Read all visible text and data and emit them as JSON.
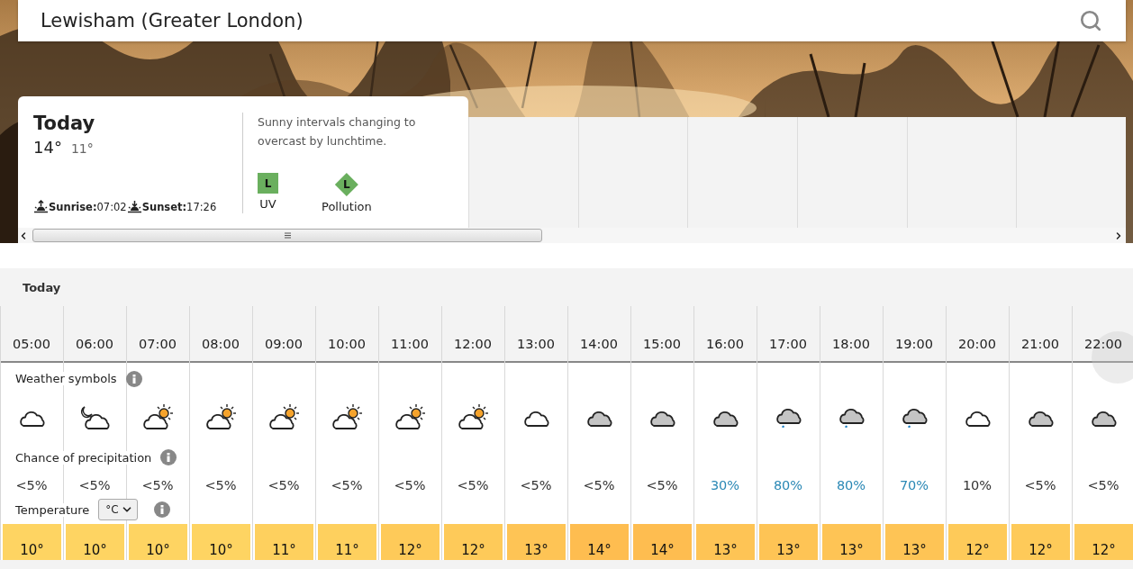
{
  "search": {
    "value": "Lewisham (Greater London)"
  },
  "today": {
    "title": "Today",
    "high": "14°",
    "low": "11°",
    "sunrise": "**Sunrise:**07:02",
    "sunset": "**Sunset:**17:26",
    "summary": "Sunny intervals changing to overcast by lunchtime.",
    "indices": [
      {
        "kind": "square",
        "value": "L",
        "label": "UV",
        "color": "#6aaf5e"
      },
      {
        "kind": "diamond",
        "value": "L",
        "label": "Pollution",
        "color": "#6aaf5e"
      }
    ]
  },
  "hourly": {
    "title": "Today",
    "symbols_label": "Weather symbols",
    "precip_label": "Chance of precipitation",
    "temp_label": "Temperature",
    "unit": "°C",
    "hours": [
      {
        "time": "05:00",
        "kind": "cloud",
        "precip": {
          "value": "<5%",
          "color": "#333333"
        },
        "temp": {
          "value": "10°",
          "color": "#fed462"
        }
      },
      {
        "time": "06:00",
        "kind": "moon",
        "precip": {
          "value": "<5%",
          "color": "#333333"
        },
        "temp": {
          "value": "10°",
          "color": "#fed462"
        }
      },
      {
        "time": "07:00",
        "kind": "sunny",
        "precip": {
          "value": "<5%",
          "color": "#333333"
        },
        "temp": {
          "value": "10°",
          "color": "#fed462"
        }
      },
      {
        "time": "08:00",
        "kind": "sunny",
        "precip": {
          "value": "<5%",
          "color": "#333333"
        },
        "temp": {
          "value": "10°",
          "color": "#fed462"
        }
      },
      {
        "time": "09:00",
        "kind": "sunny",
        "precip": {
          "value": "<5%",
          "color": "#333333"
        },
        "temp": {
          "value": "11°",
          "color": "#fed05e"
        }
      },
      {
        "time": "10:00",
        "kind": "sunny",
        "precip": {
          "value": "<5%",
          "color": "#333333"
        },
        "temp": {
          "value": "11°",
          "color": "#fed05e"
        }
      },
      {
        "time": "11:00",
        "kind": "sunny",
        "precip": {
          "value": "<5%",
          "color": "#333333"
        },
        "temp": {
          "value": "12°",
          "color": "#feca59"
        }
      },
      {
        "time": "12:00",
        "kind": "sunny",
        "precip": {
          "value": "<5%",
          "color": "#333333"
        },
        "temp": {
          "value": "12°",
          "color": "#feca59"
        }
      },
      {
        "time": "13:00",
        "kind": "cloud",
        "precip": {
          "value": "<5%",
          "color": "#333333"
        },
        "temp": {
          "value": "13°",
          "color": "#fec455"
        }
      },
      {
        "time": "14:00",
        "kind": "overcast",
        "precip": {
          "value": "<5%",
          "color": "#333333"
        },
        "temp": {
          "value": "14°",
          "color": "#febd50"
        }
      },
      {
        "time": "15:00",
        "kind": "overcast",
        "precip": {
          "value": "<5%",
          "color": "#333333"
        },
        "temp": {
          "value": "14°",
          "color": "#febd50"
        }
      },
      {
        "time": "16:00",
        "kind": "overcast",
        "precip": {
          "value": "30%",
          "color": "#2a88b5"
        },
        "temp": {
          "value": "13°",
          "color": "#fec455"
        }
      },
      {
        "time": "17:00",
        "kind": "rain",
        "precip": {
          "value": "80%",
          "color": "#2a88b5"
        },
        "temp": {
          "value": "13°",
          "color": "#fec455"
        }
      },
      {
        "time": "18:00",
        "kind": "rain",
        "precip": {
          "value": "80%",
          "color": "#2a88b5"
        },
        "temp": {
          "value": "13°",
          "color": "#fec455"
        }
      },
      {
        "time": "19:00",
        "kind": "rain",
        "precip": {
          "value": "70%",
          "color": "#2a88b5"
        },
        "temp": {
          "value": "13°",
          "color": "#fec455"
        }
      },
      {
        "time": "20:00",
        "kind": "cloud",
        "precip": {
          "value": "10%",
          "color": "#333333"
        },
        "temp": {
          "value": "12°",
          "color": "#feca59"
        }
      },
      {
        "time": "21:00",
        "kind": "overcast",
        "precip": {
          "value": "<5%",
          "color": "#333333"
        },
        "temp": {
          "value": "12°",
          "color": "#feca59"
        }
      },
      {
        "time": "22:00",
        "kind": "overcast",
        "precip": {
          "value": "<5%",
          "color": "#333333"
        },
        "temp": {
          "value": "12°",
          "color": "#feca59"
        }
      }
    ]
  }
}
